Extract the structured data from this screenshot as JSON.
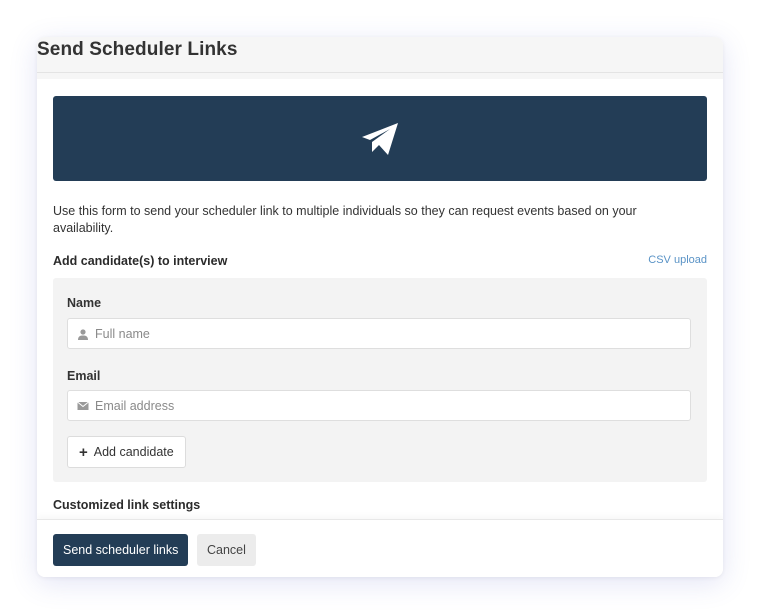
{
  "modal": {
    "title": "Send Scheduler Links",
    "banner_icon": "paper-plane-icon",
    "intro": "Use this form to send your scheduler link to multiple individuals so they can request events based on your availability.",
    "candidates_label": "Add candidate(s) to interview",
    "csv_upload": "CSV upload",
    "name_label": "Name",
    "name_placeholder": "Full name",
    "name_icon": "user-icon",
    "email_label": "Email",
    "email_placeholder": "Email address",
    "email_icon": "envelope-icon",
    "add_candidate": "Add candidate",
    "custom_settings_label": "Customized link settings"
  },
  "footer": {
    "send_label": "Send scheduler links",
    "cancel_label": "Cancel"
  },
  "colors": {
    "primary": "#233d56",
    "link": "#5a93c6",
    "panel_bg": "#f3f3f3"
  }
}
